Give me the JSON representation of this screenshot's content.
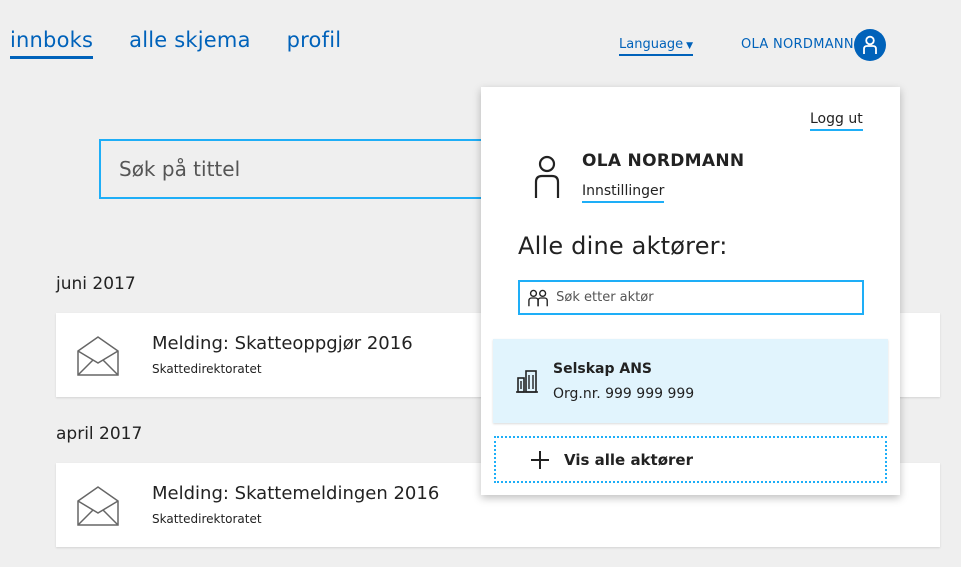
{
  "nav": {
    "tabs": [
      {
        "label": "innboks",
        "active": true
      },
      {
        "label": "alle skjema",
        "active": false
      },
      {
        "label": "profil",
        "active": false
      }
    ]
  },
  "header": {
    "language_label": "Language",
    "user_name": "OLA NORDMANN"
  },
  "search": {
    "placeholder": "Søk på tittel"
  },
  "messages": [
    {
      "month": "juni 2017",
      "title": "Melding: Skatteoppgjør 2016",
      "sender": "Skattedirektoratet"
    },
    {
      "month": "april 2017",
      "title": "Melding: Skattemeldingen 2016",
      "sender": "Skattedirektoratet"
    }
  ],
  "profile_menu": {
    "logout_label": "Logg ut",
    "user_name": "OLA NORDMANN",
    "settings_label": "Innstillinger",
    "actors_heading": "Alle dine aktører:",
    "actor_search_placeholder": "Søk etter aktør",
    "actor": {
      "name": "Selskap ANS",
      "org": "Org.nr. 999 999 999"
    },
    "show_all_label": "Vis alle aktører"
  },
  "colors": {
    "brand_blue": "#0062ba",
    "accent_cyan": "#1eaef7",
    "actor_bg": "#e1f4fd",
    "page_bg": "#efefef"
  }
}
